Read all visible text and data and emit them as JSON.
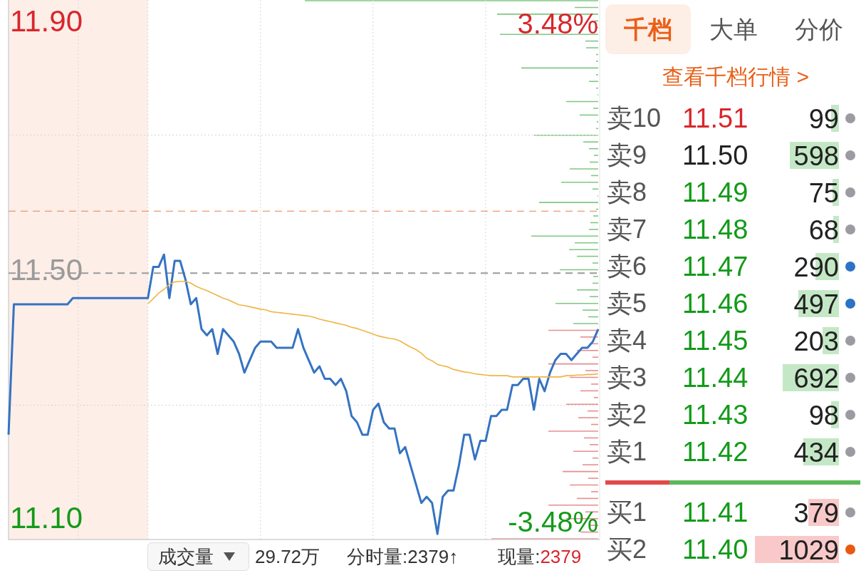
{
  "chart": {
    "chart_data": [
      {
        "type": "line",
        "series": [
          {
            "color": "#3573c2",
            "values": [
              11.24,
              11.45,
              11.45,
              11.45,
              11.45,
              11.45,
              11.45,
              11.45,
              11.45,
              11.45,
              11.45,
              11.45,
              11.46,
              11.46,
              11.46,
              11.46,
              11.46,
              11.46,
              11.46,
              11.46,
              11.46,
              11.46,
              11.46,
              11.46,
              11.46,
              11.46,
              11.46,
              11.51,
              11.51,
              11.53,
              11.46,
              11.52,
              11.52,
              11.49,
              11.45,
              11.46,
              11.41,
              11.4,
              11.41,
              11.37,
              11.41,
              11.4,
              11.39,
              11.37,
              11.34,
              11.36,
              11.38,
              11.39,
              11.39,
              11.39,
              11.38,
              11.38,
              11.38,
              11.38,
              11.41,
              11.38,
              11.36,
              11.34,
              11.35,
              11.33,
              11.33,
              11.32,
              11.33,
              11.31,
              11.27,
              11.26,
              11.24,
              11.24,
              11.28,
              11.29,
              11.26,
              11.25,
              11.25,
              11.21,
              11.22,
              11.19,
              11.16,
              11.13,
              11.14,
              11.13,
              11.08,
              11.14,
              11.15,
              11.15,
              11.19,
              11.24,
              11.24,
              11.2,
              11.23,
              11.23,
              11.27,
              11.27,
              11.28,
              11.28,
              11.32,
              11.32,
              11.33,
              11.33,
              11.28,
              11.33,
              11.31,
              11.34,
              11.36,
              11.37,
              11.37,
              11.36,
              11.37,
              11.38,
              11.38,
              11.39,
              11.41
            ]
          },
          {
            "color": "#f0b546",
            "values": [
              null,
              null,
              null,
              null,
              null,
              null,
              null,
              null,
              null,
              null,
              null,
              null,
              null,
              null,
              null,
              null,
              null,
              null,
              null,
              null,
              null,
              null,
              null,
              null,
              null,
              null,
              11.451,
              11.459,
              11.468,
              11.474,
              11.482,
              11.486,
              11.487,
              11.487,
              11.484,
              11.479,
              11.475,
              11.472,
              11.468,
              11.464,
              11.46,
              11.457,
              11.453,
              11.449,
              11.448,
              11.446,
              11.444,
              11.442,
              11.441,
              11.438,
              11.437,
              11.436,
              11.435,
              11.434,
              11.433,
              11.432,
              11.431,
              11.429,
              11.426,
              11.424,
              11.422,
              11.42,
              11.418,
              11.416,
              11.413,
              11.411,
              11.408,
              11.405,
              11.402,
              11.399,
              11.397,
              11.395,
              11.394,
              11.391,
              11.386,
              11.381,
              11.377,
              11.371,
              11.363,
              11.359,
              11.353,
              11.351,
              11.349,
              11.345,
              11.343,
              11.341,
              11.34,
              11.338,
              11.337,
              11.336,
              11.335,
              11.335,
              11.335,
              11.335,
              11.333,
              11.333,
              11.333,
              11.333,
              11.333,
              11.333,
              11.333,
              11.333,
              11.333,
              11.333,
              11.335,
              11.335,
              11.336,
              11.336,
              11.337,
              11.337,
              11.338
            ]
          }
        ],
        "ylim": [
          11.07,
          11.94
        ],
        "yticks": [
          {
            "value": 11.9,
            "label": "11.90"
          },
          {
            "value": 11.5,
            "label": "11.50"
          },
          {
            "value": 11.1,
            "label": "11.10"
          }
        ],
        "y2lim": [
          -3.69,
          3.85
        ],
        "y2ticks": [
          {
            "value": 3.48,
            "label": "3.48%"
          },
          {
            "value": -3.48,
            "label": "-3.48%"
          }
        ],
        "ref_lines": [
          {
            "axis": "y",
            "value": 11.5,
            "color": "#9a9a9a",
            "line_style": "dashed"
          },
          {
            "axis": "y",
            "value": 11.6,
            "color": "#e0824f",
            "line_style": "dashed"
          }
        ],
        "grid": true
      }
    ]
  },
  "volume_bar": {
    "selector": "成交量",
    "total": "29.72万",
    "minute_volume": "分时量:2379↑",
    "current_label": "现量:",
    "current_value": "2379"
  },
  "order_tabs": [
    {
      "label": "千档",
      "selected": true
    },
    {
      "label": "大单",
      "selected": false
    },
    {
      "label": "分价",
      "selected": false
    }
  ],
  "depth_link": "查看千档行情 >",
  "asks": [
    {
      "label": "卖10",
      "price": "11.51",
      "quantity": "99",
      "color": "#9b9ba1"
    },
    {
      "label": "卖9",
      "price": "11.50",
      "quantity": "598",
      "color": "#9b9ba1"
    },
    {
      "label": "卖8",
      "price": "11.49",
      "quantity": "75",
      "color": "#9b9ba1"
    },
    {
      "label": "卖7",
      "price": "11.48",
      "quantity": "68",
      "color": "#9b9ba1"
    },
    {
      "label": "卖6",
      "price": "11.47",
      "quantity": "290",
      "color": "#2c72c7"
    },
    {
      "label": "卖5",
      "price": "11.46",
      "quantity": "497",
      "color": "#2c72c7"
    },
    {
      "label": "卖4",
      "price": "11.45",
      "quantity": "203",
      "color": "#9b9ba1"
    },
    {
      "label": "卖3",
      "price": "11.44",
      "quantity": "692",
      "color": "#9b9ba1"
    },
    {
      "label": "卖2",
      "price": "11.43",
      "quantity": "98",
      "color": "#9b9ba1"
    },
    {
      "label": "卖1",
      "price": "11.42",
      "quantity": "434",
      "color": "#9b9ba1"
    }
  ],
  "ratio_bar": {
    "level": 0.25
  },
  "bids": [
    {
      "label": "买1",
      "price": "11.41",
      "quantity": "379",
      "color": "#9b9ba1"
    },
    {
      "label": "买2",
      "price": "11.40",
      "quantity": "1029",
      "color": "#e85a10"
    }
  ]
}
